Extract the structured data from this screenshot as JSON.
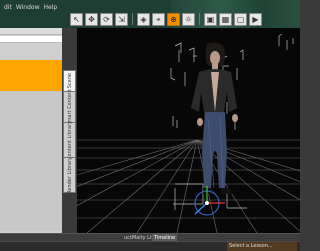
{
  "menu": {
    "items": [
      "dit",
      "Window",
      "Help"
    ]
  },
  "toolbar": {
    "buttons": [
      {
        "icon": "select-icon",
        "glyph": "↖"
      },
      {
        "icon": "move-icon",
        "glyph": "✥"
      },
      {
        "icon": "rotate-icon",
        "glyph": "⟳"
      },
      {
        "icon": "scale-icon",
        "glyph": "⇲"
      },
      {
        "icon": "node-icon",
        "glyph": "◈"
      },
      {
        "icon": "camera-icon",
        "glyph": "⌖"
      },
      {
        "icon": "target-icon",
        "glyph": "⊕",
        "active": true
      },
      {
        "icon": "light-icon",
        "glyph": "☼"
      },
      {
        "icon": "render-icon",
        "glyph": "▣"
      },
      {
        "icon": "grid-icon",
        "glyph": "▦"
      },
      {
        "icon": "frame-icon",
        "glyph": "▢"
      },
      {
        "icon": "play-icon",
        "glyph": "▶"
      }
    ],
    "accent": "#f29000"
  },
  "left_tabs": [
    "Scene",
    "Smart Content",
    "Content Library",
    "Render Library"
  ],
  "bottom_tabs": [
    "uctMaity Lite",
    "Timeline"
  ],
  "status": {
    "text": "Select a Lesson..."
  }
}
